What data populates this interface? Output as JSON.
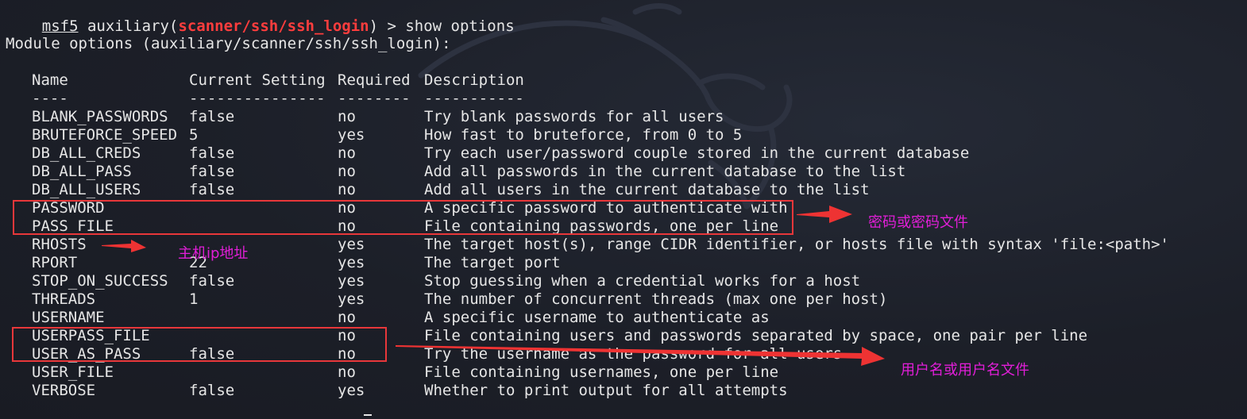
{
  "prompt": {
    "shell": "msf5",
    "module_prefix": " auxiliary(",
    "module_path": "scanner/ssh/ssh_login",
    "suffix": ") > ",
    "command": "show options"
  },
  "module_options_title": "Module options (auxiliary/scanner/ssh/ssh_login):",
  "table": {
    "headers": {
      "name": "Name",
      "setting": "Current Setting",
      "required": "Required",
      "description": "Description"
    },
    "underlines": {
      "name": "----",
      "setting": "---------------",
      "required": "--------",
      "description": "-----------"
    },
    "rows": [
      {
        "name": "BLANK_PASSWORDS",
        "setting": "false",
        "required": "no",
        "description": "Try blank passwords for all users"
      },
      {
        "name": "BRUTEFORCE_SPEED",
        "setting": "5",
        "required": "yes",
        "description": "How fast to bruteforce, from 0 to 5"
      },
      {
        "name": "DB_ALL_CREDS",
        "setting": "false",
        "required": "no",
        "description": "Try each user/password couple stored in the current database"
      },
      {
        "name": "DB_ALL_PASS",
        "setting": "false",
        "required": "no",
        "description": "Add all passwords in the current database to the list"
      },
      {
        "name": "DB_ALL_USERS",
        "setting": "false",
        "required": "no",
        "description": "Add all users in the current database to the list"
      },
      {
        "name": "PASSWORD",
        "setting": "",
        "required": "no",
        "description": "A specific password to authenticate with"
      },
      {
        "name": "PASS_FILE",
        "setting": "",
        "required": "no",
        "description": "File containing passwords, one per line"
      },
      {
        "name": "RHOSTS",
        "setting": "",
        "required": "yes",
        "description": "The target host(s), range CIDR identifier, or hosts file with syntax 'file:<path>'"
      },
      {
        "name": "RPORT",
        "setting": "22",
        "required": "yes",
        "description": "The target port"
      },
      {
        "name": "STOP_ON_SUCCESS",
        "setting": "false",
        "required": "yes",
        "description": "Stop guessing when a credential works for a host"
      },
      {
        "name": "THREADS",
        "setting": "1",
        "required": "yes",
        "description": "The number of concurrent threads (max one per host)"
      },
      {
        "name": "USERNAME",
        "setting": "",
        "required": "no",
        "description": "A specific username to authenticate as"
      },
      {
        "name": "USERPASS_FILE",
        "setting": "",
        "required": "no",
        "description": "File containing users and passwords separated by space, one pair per line"
      },
      {
        "name": "USER_AS_PASS",
        "setting": "false",
        "required": "no",
        "description": "Try the username as the password for all users"
      },
      {
        "name": "USER_FILE",
        "setting": "",
        "required": "no",
        "description": "File containing usernames, one per line"
      },
      {
        "name": "VERBOSE",
        "setting": "false",
        "required": "yes",
        "description": "Whether to print output for all attempts"
      }
    ]
  },
  "annotations": {
    "password_label": "密码或密码文件",
    "host_label": "主机ip地址",
    "user_label": "用户名或用户名文件",
    "box_color": "#e8373a",
    "arrow_color": "#ee3333",
    "label_color": "#e21ed8"
  },
  "colors": {
    "background": "#1b1e27",
    "text": "#e6e6e6",
    "module_path": "#ff3d3d"
  },
  "icons": {
    "background_logo": "kali-dragon-icon"
  }
}
